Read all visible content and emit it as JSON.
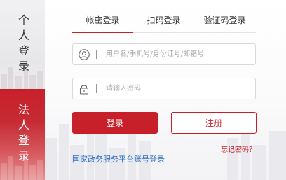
{
  "side_tabs": {
    "personal": "个人登录",
    "legal": "法人登录"
  },
  "tabs": [
    {
      "label": "帐密登录",
      "active": true
    },
    {
      "label": "扫码登录",
      "active": false
    },
    {
      "label": "验证码登录",
      "active": false
    }
  ],
  "form": {
    "username_placeholder": "用户名/手机号/身份证号/邮箱号",
    "username_icon": "user-icon",
    "password_placeholder": "请输入密码",
    "password_icon": "lock-icon"
  },
  "buttons": {
    "login": "登录",
    "register": "注册"
  },
  "links": {
    "forgot": "忘记密码？",
    "gov_platform": "国家政务服务平台账号登录"
  },
  "colors": {
    "accent": "#c8202a",
    "link": "#2a6bc2"
  }
}
